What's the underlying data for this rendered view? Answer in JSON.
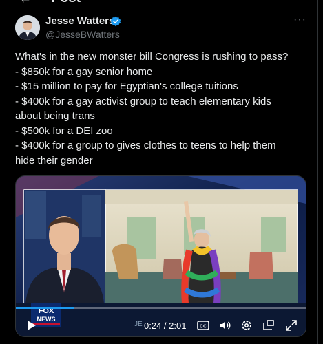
{
  "header": {
    "title": "Post"
  },
  "author": {
    "name": "Jesse Watters",
    "handle": "@JesseBWatters",
    "verified": true
  },
  "tweet": {
    "lines": [
      "What's in the new monster bill Congress is rushing to pass?",
      "- $850k for a gay senior home",
      "- $15 million to pay for Egyptian's college tuitions",
      "- $400k for a gay activist group to teach elementary kids",
      "about being trans",
      "- $500k for a DEI zoo",
      "- $400k for a group to gives clothes to teens to help them",
      "hide their gender"
    ]
  },
  "video": {
    "current_time": "0:24",
    "duration": "2:01",
    "time_display": "0:24 / 2:01",
    "progress": 0.2,
    "overlay_logo_text": "FOX NEWS",
    "overlay_ghost_text": "JE"
  },
  "icons": {
    "back": "back-arrow-icon",
    "more": "more-dots-icon",
    "play": "play-icon",
    "cc": "captions-icon",
    "volume": "volume-icon",
    "settings": "settings-gear-icon",
    "pip": "picture-in-picture-icon",
    "fullscreen": "fullscreen-icon"
  },
  "colors": {
    "background": "#000000",
    "text": "#e7e9ea",
    "muted": "#71767b",
    "accent": "#1d9bf0"
  }
}
